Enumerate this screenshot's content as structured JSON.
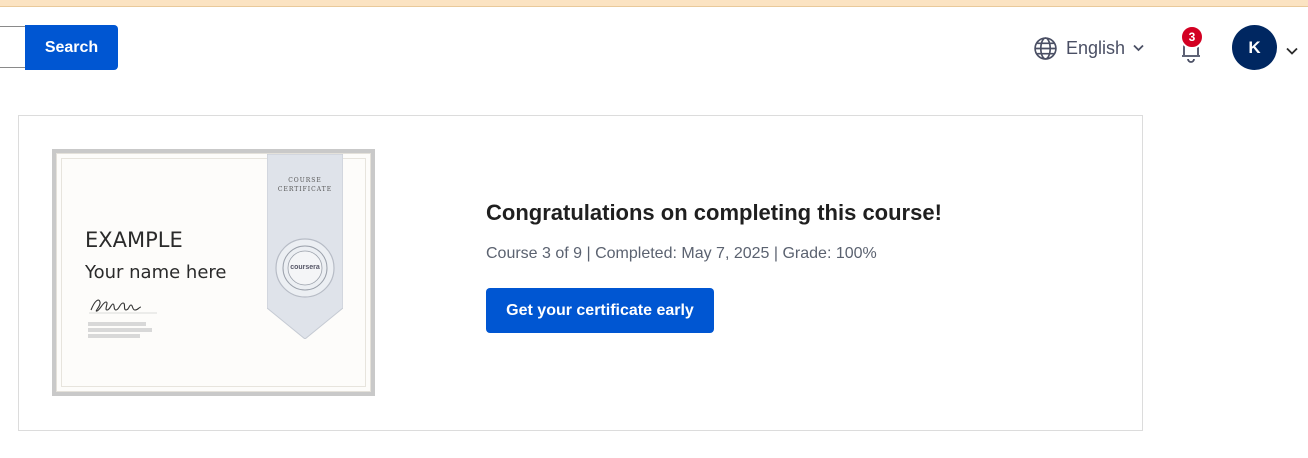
{
  "header": {
    "search": {
      "value": "",
      "button_label": "Search"
    },
    "language": {
      "label": "English",
      "icon": "globe-icon"
    },
    "notifications": {
      "count": "3",
      "icon": "bell-icon"
    },
    "user": {
      "initial": "K"
    }
  },
  "certificate_preview": {
    "heading": "EXAMPLE",
    "name_placeholder": "Your name here",
    "ribbon_label_line1": "COURSE",
    "ribbon_label_line2": "CERTIFICATE",
    "seal_text": "coursera"
  },
  "completion": {
    "title": "Congratulations on completing this course!",
    "meta": "Course 3 of 9 | Completed: May 7, 2025 | Grade: 100%",
    "cta_label": "Get your certificate early"
  },
  "colors": {
    "primary": "#0056d2",
    "badge": "#d30022",
    "avatar": "#002761"
  }
}
